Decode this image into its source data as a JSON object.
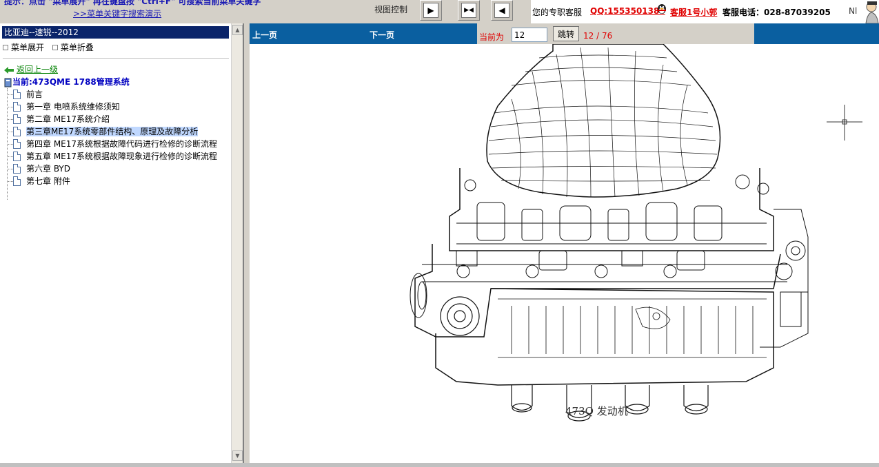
{
  "hints": {
    "line1": "提示：点击 \"菜单展开\" 再在键盘按 \"Ctrl+F\" 可搜索当前菜单关键字",
    "line2": ">>菜单关键字搜索演示"
  },
  "view_control": {
    "label": "视图控制"
  },
  "contact": {
    "label": "您的专职客服",
    "qq": "QQ:1553501388",
    "service": "客服1号小郭",
    "phone": "客服电话：028-87039205",
    "nl": "Nl"
  },
  "sidebar": {
    "title": "比亚迪--速锐--2012",
    "expand": "菜单展开",
    "collapse": "菜单折叠",
    "back": "返回上一级",
    "current": "当前:473QME 1788管理系统",
    "items": [
      {
        "label": "前言"
      },
      {
        "label": "第一章 电喷系统维修须知"
      },
      {
        "label": "第二章 ME17系统介绍"
      },
      {
        "label": "第三章ME17系统零部件结构、原理及故障分析"
      },
      {
        "label": "第四章 ME17系统根据故障代码进行检修的诊断流程"
      },
      {
        "label": "第五章 ME17系统根据故障现象进行检修的诊断流程"
      },
      {
        "label": "第六章 BYD"
      },
      {
        "label": "第七章 附件"
      }
    ]
  },
  "nav": {
    "prev": "上一页",
    "next": "下一页",
    "current_label": "当前为",
    "page_value": "12",
    "go": "跳转",
    "count": "12 / 76"
  },
  "figure": {
    "caption": "473Q 发动机"
  }
}
